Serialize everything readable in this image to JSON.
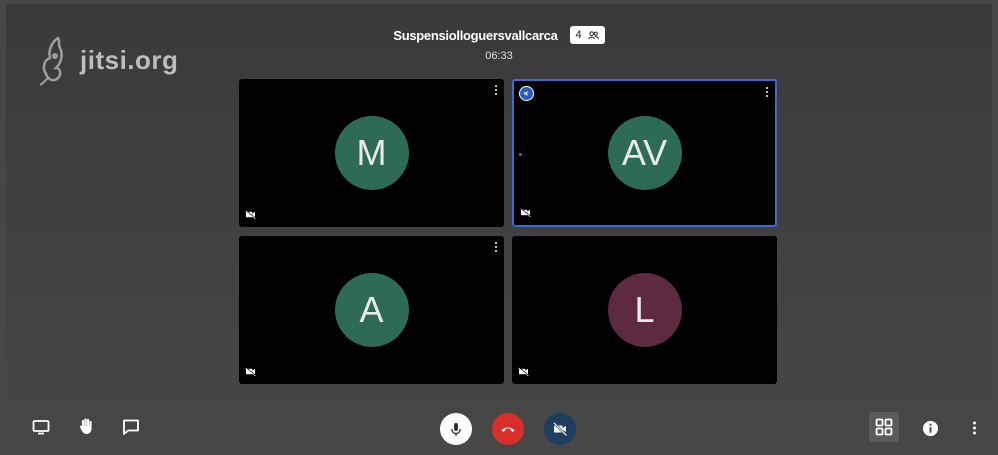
{
  "logo": {
    "text": "jitsi.org"
  },
  "header": {
    "meeting_title": "Suspensiolloguersvallcarca",
    "participant_count": "4",
    "timer": "06:33"
  },
  "tiles": [
    {
      "initials": "M",
      "color": "#2e6b57"
    },
    {
      "initials": "AV",
      "color": "#2e6b57",
      "dominant_speaker": true
    },
    {
      "initials": "A",
      "color": "#2e6b57"
    },
    {
      "initials": "L",
      "color": "#5e2a42"
    }
  ],
  "toolbar": {
    "left": [
      "screen-share-icon",
      "raise-hand-icon",
      "chat-icon"
    ],
    "center": [
      "microphone-icon",
      "hangup-icon",
      "camera-off-icon"
    ],
    "right": [
      "tile-view-icon",
      "info-icon",
      "more-options-icon"
    ]
  },
  "colors": {
    "hangup": "#d92f2b",
    "camera_button": "#1f3d5e",
    "active_border": "#3b6bd6"
  }
}
